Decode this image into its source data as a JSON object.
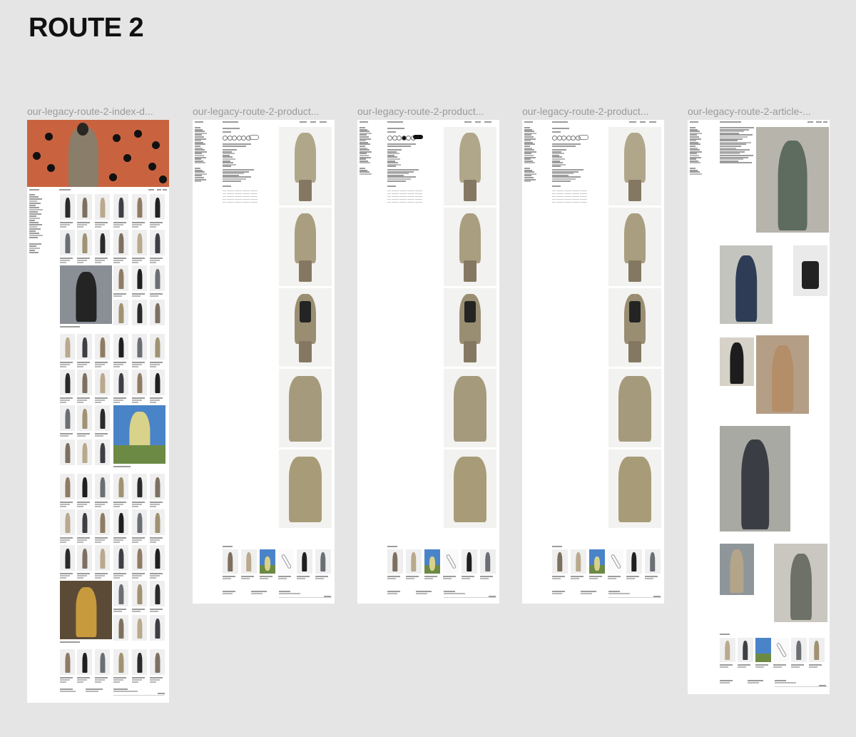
{
  "page": {
    "title": "ROUTE 2"
  },
  "frames": [
    {
      "id": "index",
      "label": "our-legacy-route-2-index-d..."
    },
    {
      "id": "product-1",
      "label": "our-legacy-route-2-product..."
    },
    {
      "id": "product-2",
      "label": "our-legacy-route-2-product..."
    },
    {
      "id": "product-3",
      "label": "our-legacy-route-2-product..."
    },
    {
      "id": "article",
      "label": "our-legacy-route-2-article-..."
    }
  ],
  "colors": {
    "canvas": "#e5e5e5",
    "frame": "#ffffff",
    "hero_orange": "#c9633f",
    "coat_khaki": "#a59a7c",
    "trouser_brown": "#857862",
    "sky_blue": "#4a84c8",
    "grass_green": "#6d8a45",
    "jacket_black": "#242424"
  }
}
